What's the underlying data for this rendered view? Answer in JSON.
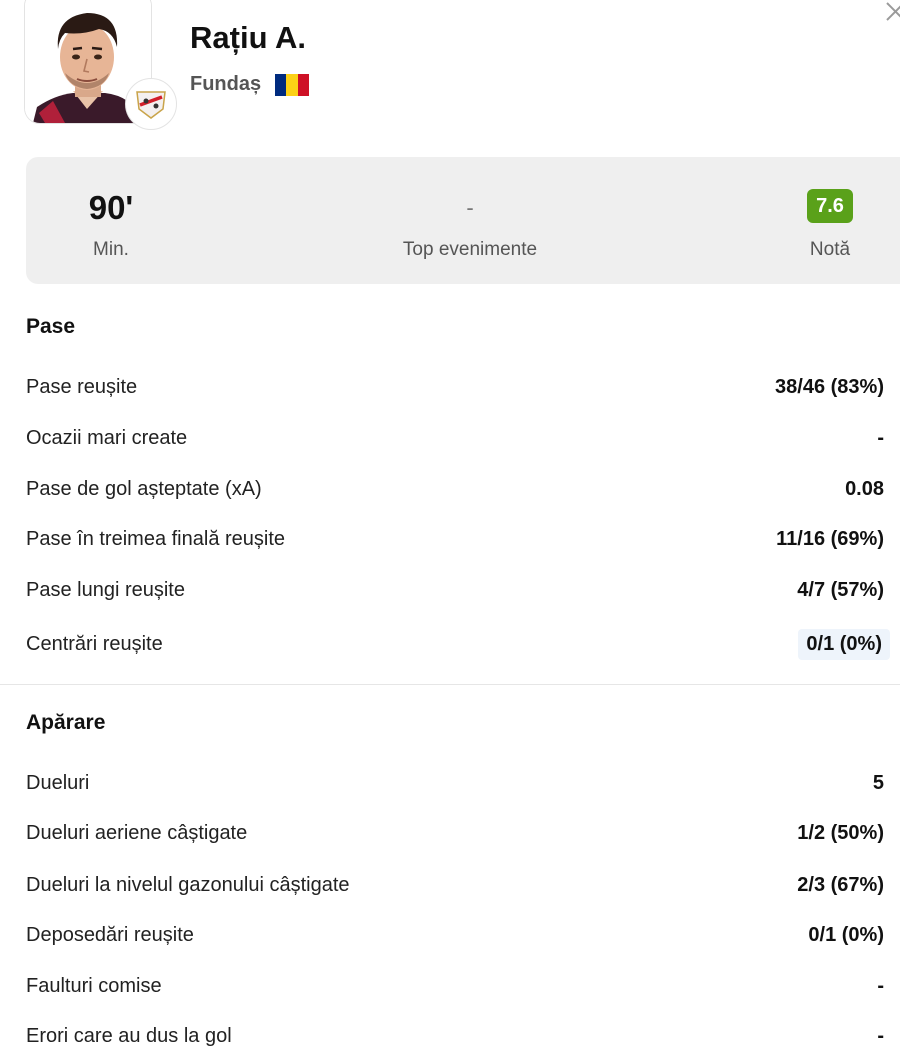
{
  "player": {
    "name": "Rațiu A.",
    "position": "Fundaș",
    "flag_colors": [
      "#002B7F",
      "#FCD116",
      "#CE1126"
    ]
  },
  "summary": {
    "minutes_value": "90'",
    "minutes_label": "Min.",
    "events_value": "-",
    "events_label": "Top evenimente",
    "rating_value": "7.6",
    "rating_label": "Notă",
    "rating_color": "#5aa11a"
  },
  "sections": {
    "passes": {
      "title": "Pase",
      "rows": [
        {
          "label": "Pase reușite",
          "value": "38/46 (83%)"
        },
        {
          "label": "Ocazii mari create",
          "value": "-"
        },
        {
          "label": "Pase de gol așteptate (xA)",
          "value": "0.08"
        },
        {
          "label": "Pase în treimea finală reușite",
          "value": "11/16 (69%)"
        },
        {
          "label": "Pase lungi reușite",
          "value": "4/7 (57%)"
        },
        {
          "label": "Centrări reușite",
          "value": "0/1 (0%)"
        }
      ]
    },
    "defense": {
      "title": "Apărare",
      "rows": [
        {
          "label": "Dueluri",
          "value": "5"
        },
        {
          "label": "Dueluri aeriene câștigate",
          "value": "1/2 (50%)"
        },
        {
          "label": "Dueluri la nivelul gazonului câștigate",
          "value": "2/3 (67%)"
        },
        {
          "label": "Deposedări reușite",
          "value": "0/1 (0%)"
        },
        {
          "label": "Faulturi comise",
          "value": "-"
        },
        {
          "label": "Erori care au dus la gol",
          "value": "-"
        }
      ]
    }
  }
}
